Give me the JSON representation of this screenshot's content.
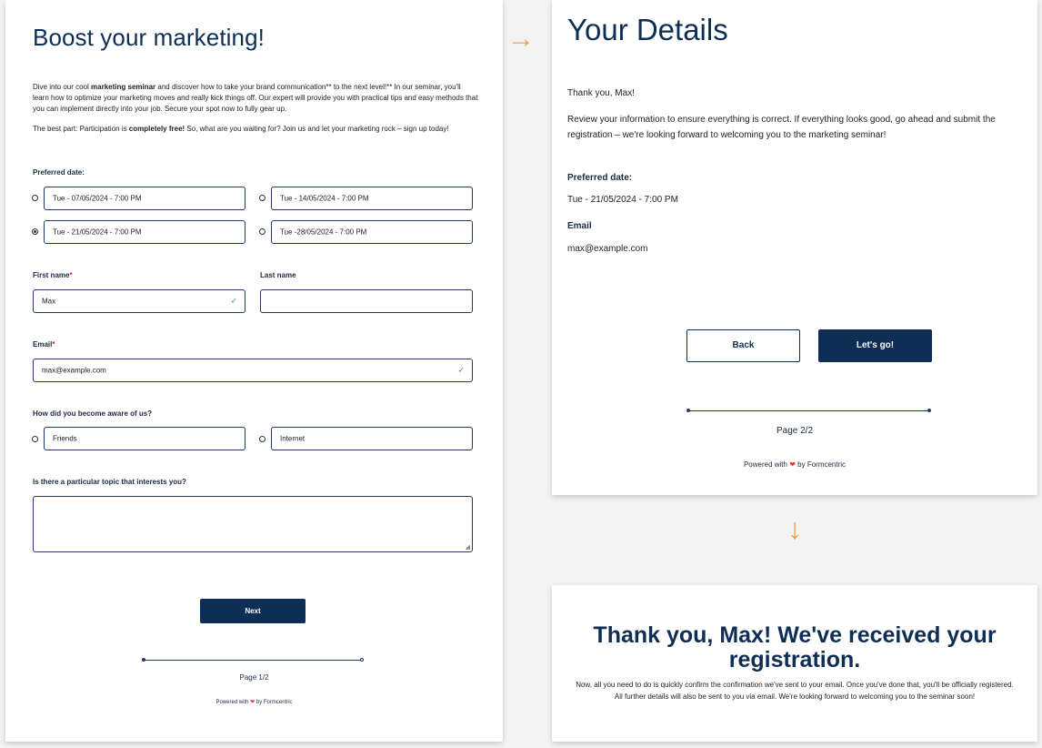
{
  "page1": {
    "title": "Boost your marketing!",
    "intro_p1_a": "Dive into our cool ",
    "intro_p1_b": "marketing seminar",
    "intro_p1_c": " and discover how to take your brand communication** to the next level!** In our seminar, you'll learn how to optimize your marketing moves and really kick things off. Our expert will provide you with practical tips and easy methods that you can implement directly into your job. Secure your spot now to fully gear up.",
    "intro_p2_a": "The best part: Participation is ",
    "intro_p2_b": "completely free!",
    "intro_p2_c": " So, what are you waiting for? Join us and let your marketing rock – sign up today!",
    "preferred_date_label": "Preferred date:",
    "dates": [
      {
        "label": "Tue - 07/05/2024 - 7:00 PM",
        "checked": false
      },
      {
        "label": "Tue - 14/05/2024 - 7:00 PM",
        "checked": false
      },
      {
        "label": "Tue - 21/05/2024 - 7:00 PM",
        "checked": true
      },
      {
        "label": "Tue -28/05/2024 - 7:00 PM",
        "checked": false
      }
    ],
    "first_name_label": "First name",
    "required_mark": "*",
    "first_name_value": "Max",
    "last_name_label": "Last name",
    "last_name_value": "",
    "email_label": "Email",
    "email_value": "max@example.com",
    "aware_label": "How did you become aware of us?",
    "aware_options": [
      "Friends",
      "Internet"
    ],
    "topic_label": "Is there a particular topic that interests you?",
    "topic_value": "",
    "next_button": "Next",
    "page_indicator": "Page 1/2",
    "powered_prefix": "Powered with",
    "powered_suffix": "by Formcentric"
  },
  "page2": {
    "title": "Your Details",
    "thanks": "Thank you, Max!",
    "review_text": "Review your information to ensure everything is correct. If everything looks good, go ahead and submit the registration – we're looking forward to welcoming you to the marketing seminar!",
    "preferred_date_label": "Preferred date:",
    "preferred_date_value": "Tue - 21/05/2024 - 7:00 PM",
    "email_label": "Email",
    "email_value": "max@example.com",
    "back_button": "Back",
    "submit_button": "Let's go!",
    "page_indicator": "Page 2/2",
    "powered_prefix": "Powered with",
    "powered_suffix": "by Formcentric"
  },
  "page3": {
    "title": "Thank you, Max! We've received your registration.",
    "message": "Now, all you need to do is quickly confirm the confirmation we've sent to your email. Once you've done that, you'll be officially registered. All further details will also be sent to you via email. We're looking forward to welcoming you to the seminar soon!"
  },
  "icons": {
    "arrow_right": "→",
    "arrow_down": "↓",
    "check": "✓",
    "heart": "❤"
  },
  "colors": {
    "brand_navy": "#0e2e55",
    "arrow_orange": "#f0a24a",
    "required_red": "#dd2222",
    "valid_green": "#2ca46a"
  }
}
